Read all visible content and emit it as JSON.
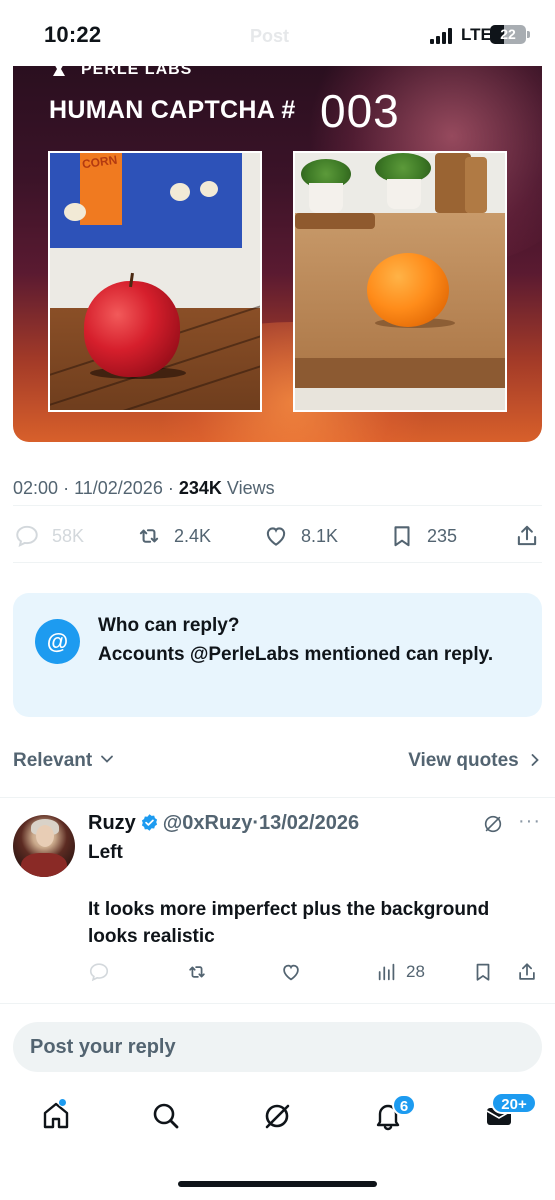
{
  "status_bar": {
    "time": "10:22",
    "faded_title": "Post",
    "network": "LTE",
    "battery": "22"
  },
  "media": {
    "brand": "PERLE LABS",
    "title": "HUMAN CAPTCHA #",
    "number": "003",
    "left_photo_text": "CORN"
  },
  "post": {
    "time": "02:00",
    "date": "11/02/2026",
    "views_count": "234K",
    "views_label": "Views",
    "sep": "·",
    "replies": "58K",
    "reposts": "2.4K",
    "likes": "8.1K",
    "bookmarks": "235"
  },
  "who_can_reply": {
    "title": "Who can reply?",
    "description": "Accounts @PerleLabs mentioned can reply."
  },
  "sort": {
    "label": "Relevant",
    "view_quotes": "View quotes"
  },
  "reply": {
    "name": "Ruzy",
    "handle": "@0xRuzy",
    "sep": "·",
    "date": "13/02/2026",
    "text1": "Left",
    "text2": "It looks more imperfect plus the background looks realistic",
    "views": "28"
  },
  "reply_input": {
    "placeholder": "Post your reply"
  },
  "nav": {
    "notifications_badge": "6",
    "messages_badge": "20+"
  },
  "colors": {
    "accent": "#1d9bf0",
    "secondary_text": "#536471",
    "reply_box_bg": "#e8f5fd"
  }
}
